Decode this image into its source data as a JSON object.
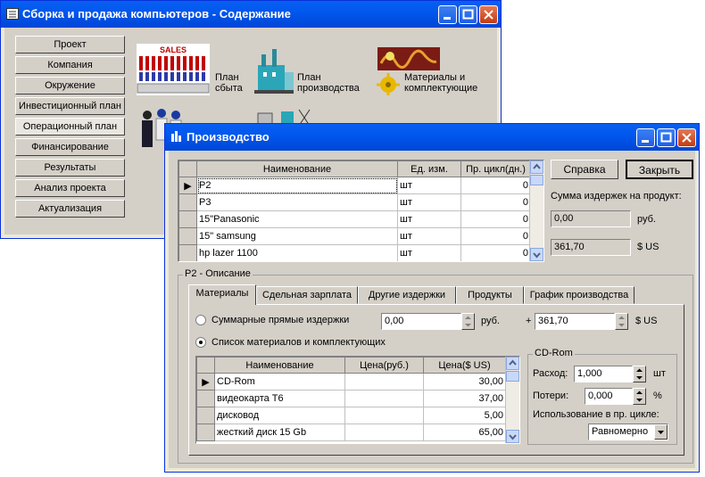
{
  "main_window": {
    "title": "Сборка и продажа компьютеров - Содержание",
    "nav": [
      "Проект",
      "Компания",
      "Окружение",
      "Инвестиционный план",
      "Операционный план",
      "Финансирование",
      "Результаты",
      "Анализ проекта",
      "Актуализация"
    ],
    "active_nav": "Операционный план",
    "icons": {
      "sales_badge": "SALES",
      "sales_plan": "План сбыта",
      "production_plan": "План производства",
      "materials": "Материалы и комплектующие"
    }
  },
  "production_window": {
    "title": "Производство",
    "buttons": {
      "help": "Справка",
      "close": "Закрыть"
    },
    "products_table": {
      "columns": [
        "Наименование",
        "Ед. изм.",
        "Пр. цикл(дн.)"
      ],
      "rows": [
        {
          "name": "P2",
          "unit": "шт",
          "cycle": "0"
        },
        {
          "name": "P3",
          "unit": "шт",
          "cycle": "0"
        },
        {
          "name": "15\"Panasonic",
          "unit": "шт",
          "cycle": "0"
        },
        {
          "name": "15\" samsung",
          "unit": "шт",
          "cycle": "0"
        },
        {
          "name": "hp lazer 1100",
          "unit": "шт",
          "cycle": "0"
        }
      ]
    },
    "cost_label": "Сумма издержек на продукт:",
    "cost_rub": "0,00",
    "cost_rub_unit": "руб.",
    "cost_usd": "361,70",
    "cost_usd_unit": "$ US",
    "description_group": "P2 - Описание",
    "tabs": [
      "Материалы",
      "Сдельная зарплата",
      "Другие издержки",
      "Продукты",
      "График производства"
    ],
    "radio_sum": "Суммарные прямые издержки",
    "sum_rub": "0,00",
    "sum_rub_unit": "руб.",
    "plus": "+",
    "sum_usd": "361,70",
    "sum_usd_unit": "$ US",
    "radio_list": "Список материалов и комплектующих",
    "materials_table": {
      "columns": [
        "Наименование",
        "Цена(руб.)",
        "Цена($ US)"
      ],
      "rows": [
        {
          "name": "CD-Rom",
          "rub": "",
          "usd": "30,00"
        },
        {
          "name": "видеокарта  T6",
          "rub": "",
          "usd": "37,00"
        },
        {
          "name": "дисковод",
          "rub": "",
          "usd": "5,00"
        },
        {
          "name": "жесткий диск 15 Gb",
          "rub": "",
          "usd": "65,00"
        }
      ]
    },
    "cdrom_group": "CD-Rom",
    "consumption_label": "Расход:",
    "consumption_value": "1,000",
    "consumption_unit": "шт",
    "losses_label": "Потери:",
    "losses_value": "0,000",
    "losses_unit": "%",
    "usage_label": "Использование в пр. цикле:",
    "usage_value": "Равномерно"
  },
  "colors": {
    "titlebar": "#0058ee",
    "close_button": "#c13b13",
    "face": "#d4d0c8"
  }
}
